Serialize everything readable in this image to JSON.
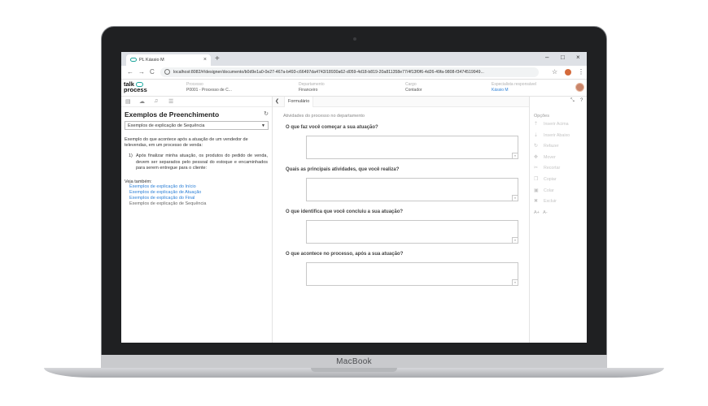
{
  "laptop": {
    "brand": "MacBook"
  },
  "browser": {
    "tab_title": "PL Kássio M",
    "tab_close": "×",
    "new_tab": "+",
    "window_controls": [
      "–",
      "□",
      "×"
    ],
    "nav": {
      "back": "←",
      "forward": "→",
      "reload": "C"
    },
    "url": "localhost:8082/#/designer/documento/b0d9e1a0-0e27-467a-b493-c66497da4743/18930a62-d059-4d18-b819-20a811358e77/4f13f0f6-4d26-49fa-9808-f3474519949..."
  },
  "app": {
    "logo": [
      "talk",
      "process"
    ],
    "meta": [
      {
        "key": "Processo",
        "value": "P0001 - Processo de C..."
      },
      {
        "key": "Departamento",
        "value": "Financeiro"
      },
      {
        "key": "Cargo",
        "value": "Contador"
      },
      {
        "key": "Especialista responsável",
        "value": "Kássio M"
      }
    ]
  },
  "left": {
    "title": "Exemplos de Preenchimento",
    "select_value": "Exemplos de explicação de Sequência",
    "intro": "Exemplo do que acontece após a atuação de um vendedor de televendas, em um processo de venda:",
    "items": [
      {
        "num": "1)",
        "text": "Após finalizar minha atuação, os produtos do pedido de venda, devem ser separados pelo pessoal do estoque e encaminhados para serem entregue para o cliente:"
      }
    ],
    "see_also_label": "Veja também:",
    "see_also": [
      "Exemplos de explicação do Início",
      "Exemplos de explicação de Atuação",
      "Exemplos de explicação do Final",
      "Exemplos de explicação de Sequência"
    ]
  },
  "main": {
    "tab": "Formulário",
    "breadcrumb": "Atividades do processo no departamento",
    "questions": [
      "O que faz você começar a sua atuação?",
      "Quais as principais atividades, que você realiza?",
      "O que identifica que você concluiu a sua atuação?",
      "O que acontece no processo, após a sua atuação?"
    ]
  },
  "right": {
    "title": "Opções",
    "options": [
      "Inserir Acima",
      "Inserir Abaixo",
      "Refazer",
      "Mover",
      "Recortar",
      "Copiar",
      "Colar",
      "Excluir"
    ],
    "font_sizes": [
      "A+",
      "A-"
    ],
    "icons": [
      "insert-above-icon",
      "insert-below-icon",
      "redo-icon",
      "move-icon",
      "cut-icon",
      "copy-icon",
      "paste-icon",
      "delete-icon"
    ]
  }
}
